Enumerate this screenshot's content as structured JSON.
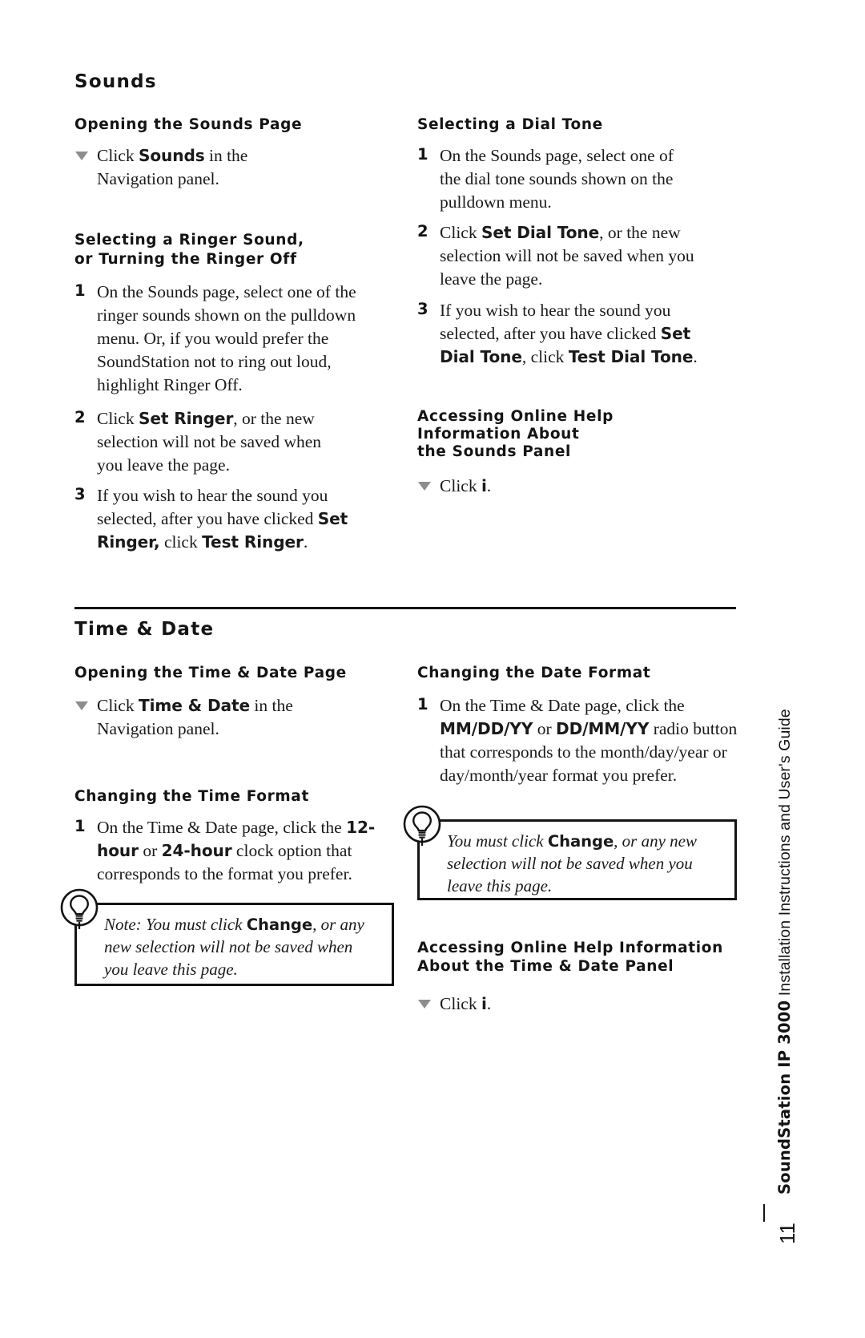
{
  "page": {
    "number": "11",
    "spine_brand": "SoundStation IP 3000",
    "spine_tail": " Installation Instructions and User's Guide"
  },
  "sections": [
    {
      "id": "sounds",
      "title": "Sounds",
      "left_column": [
        {
          "heading": "Opening the Sounds Page",
          "items": [
            {
              "marker": "triangle",
              "runs": [
                {
                  "t": "Click ",
                  "b": false
                },
                {
                  "t": "Sounds",
                  "b": true
                },
                {
                  "t": " in the Navigation panel.",
                  "b": false
                }
              ]
            }
          ]
        },
        {
          "heading": "Selecting a Ringer Sound,\nor Turning the Ringer Off",
          "items": [
            {
              "marker": "1",
              "runs": [
                {
                  "t": "On the Sounds page, select one of the ringer sounds shown on the pulldown menu. Or, if you would prefer the SoundStation not to ring out loud, highlight Ringer Off.",
                  "b": false
                }
              ]
            },
            {
              "marker": "2",
              "runs": [
                {
                  "t": "Click ",
                  "b": false
                },
                {
                  "t": "Set Ringer",
                  "b": true
                },
                {
                  "t": ", or the new selection will not be saved when you leave the page.",
                  "b": false
                }
              ]
            },
            {
              "marker": "3",
              "runs": [
                {
                  "t": "If you wish to hear the sound you selected, after you have clicked ",
                  "b": false
                },
                {
                  "t": "Set Ringer,",
                  "b": true
                },
                {
                  "t": " click ",
                  "b": false
                },
                {
                  "t": "Test Ringer",
                  "b": true
                },
                {
                  "t": ".",
                  "b": false
                }
              ]
            }
          ]
        }
      ],
      "right_column": [
        {
          "heading": "Selecting a Dial Tone",
          "items": [
            {
              "marker": "1",
              "runs": [
                {
                  "t": "On the Sounds page, select one of the dial tone sounds shown on the pulldown menu.",
                  "b": false
                }
              ]
            },
            {
              "marker": "2",
              "runs": [
                {
                  "t": "Click ",
                  "b": false
                },
                {
                  "t": "Set Dial Tone",
                  "b": true
                },
                {
                  "t": ", or the new selection will not be saved when you leave the page.",
                  "b": false
                }
              ]
            },
            {
              "marker": "3",
              "runs": [
                {
                  "t": "If you wish to hear the sound you selected, after you have clicked ",
                  "b": false
                },
                {
                  "t": "Set Dial Tone",
                  "b": true
                },
                {
                  "t": ", click ",
                  "b": false
                },
                {
                  "t": "Test Dial Tone",
                  "b": true
                },
                {
                  "t": ".",
                  "b": false
                }
              ]
            }
          ]
        },
        {
          "heading": "Accessing Online Help\nInformation About\nthe Sounds Panel",
          "items": [
            {
              "marker": "triangle",
              "runs": [
                {
                  "t": "Click ",
                  "b": false
                },
                {
                  "t": "i",
                  "b": true
                },
                {
                  "t": ".",
                  "b": false
                }
              ]
            }
          ]
        }
      ]
    },
    {
      "id": "time-and-date",
      "title": "Time & Date",
      "left_column": [
        {
          "heading": "Opening the Time & Date Page",
          "items": [
            {
              "marker": "triangle",
              "runs": [
                {
                  "t": "Click ",
                  "b": false
                },
                {
                  "t": "Time & Date",
                  "b": true
                },
                {
                  "t": " in the Navigation panel.",
                  "b": false
                }
              ]
            }
          ]
        },
        {
          "heading": "Changing the Time Format",
          "items": [
            {
              "marker": "1",
              "runs": [
                {
                  "t": "On the Time & Date page, click the ",
                  "b": false
                },
                {
                  "t": "12-hour",
                  "b": true
                },
                {
                  "t": " or ",
                  "b": false
                },
                {
                  "t": "24-hour",
                  "b": true
                },
                {
                  "t": " clock option that corresponds to the format you prefer.",
                  "b": false
                }
              ]
            }
          ]
        }
      ],
      "right_column": [
        {
          "heading": "Changing the Date Format",
          "items": [
            {
              "marker": "1",
              "runs": [
                {
                  "t": "On the Time & Date page, click the ",
                  "b": false
                },
                {
                  "t": "MM/DD/YY",
                  "b": true
                },
                {
                  "t": " or ",
                  "b": false
                },
                {
                  "t": "DD/MM/YY",
                  "b": true
                },
                {
                  "t": " radio button that corresponds to the month/day/year or day/month/year format you prefer.",
                  "b": false
                }
              ]
            }
          ]
        },
        {
          "heading": "Accessing Online Help Information\nAbout the Time & Date Panel",
          "items": [
            {
              "marker": "triangle",
              "runs": [
                {
                  "t": "Click ",
                  "b": false
                },
                {
                  "t": "i",
                  "b": true
                },
                {
                  "t": ".",
                  "b": false
                }
              ]
            }
          ]
        }
      ]
    }
  ],
  "notes": [
    {
      "id": "note-time-format",
      "runs": [
        {
          "t": "Note: You must click ",
          "b": false
        },
        {
          "t": "Change",
          "b": true
        },
        {
          "t": ", or any new selection will not be saved when you leave this page.",
          "b": false
        }
      ]
    },
    {
      "id": "note-date-format",
      "runs": [
        {
          "t": "You must click ",
          "b": false
        },
        {
          "t": "Change",
          "b": true
        },
        {
          "t": ", or any new selection will not be saved when you leave this page.",
          "b": false
        }
      ]
    }
  ],
  "colors": {
    "ink": "#141414",
    "bullet": "#8d8d8d",
    "paper": "#ffffff"
  }
}
